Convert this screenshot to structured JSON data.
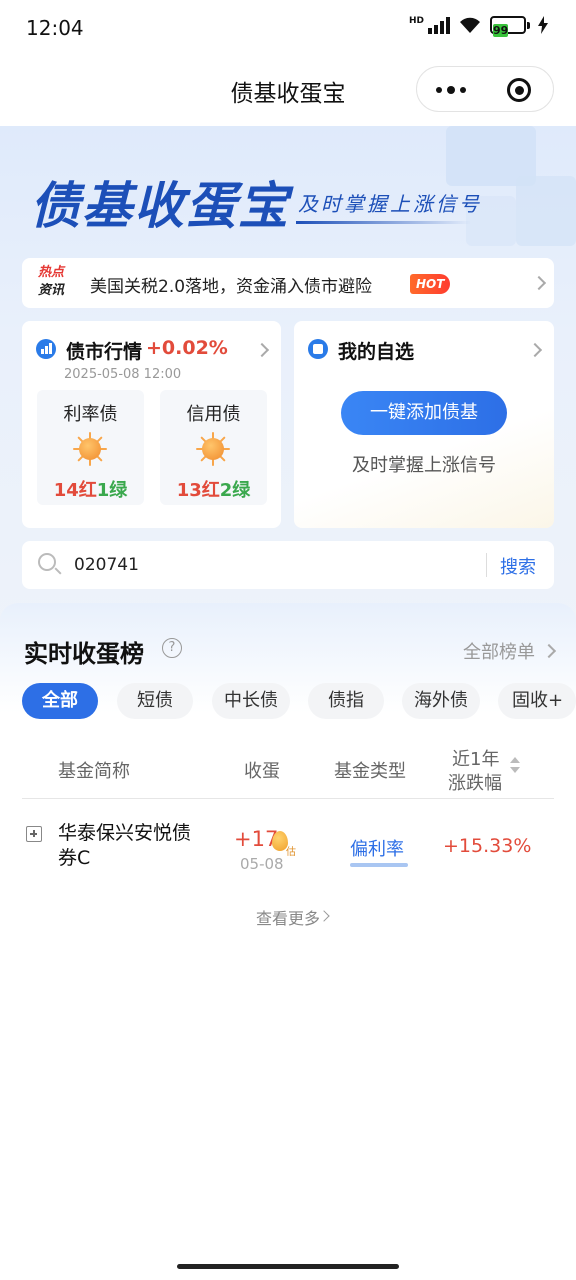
{
  "status_bar": {
    "time": "12:04",
    "network": "HD",
    "battery": "99"
  },
  "nav": {
    "title": "债基收蛋宝"
  },
  "hero": {
    "brand": "债基收蛋宝",
    "slogan": "及时掌握上涨信号"
  },
  "news": {
    "tag_top": "热点",
    "tag_bottom": "资讯",
    "headline": "美国关税2.0落地，资金涌入债市避险",
    "badge": "HOT"
  },
  "market": {
    "title": "债市行情",
    "change": "+0.02%",
    "date": "2025-05-08 12:00",
    "items": [
      {
        "name": "利率债",
        "red_count": "14红",
        "green_count": "1绿"
      },
      {
        "name": "信用债",
        "red_count": "13红",
        "green_count": "2绿"
      }
    ]
  },
  "watchlist": {
    "title": "我的自选",
    "add_button": "一键添加债基",
    "subtitle": "及时掌握上涨信号"
  },
  "search": {
    "value": "020741",
    "button": "搜索"
  },
  "ranking": {
    "title": "实时收蛋榜",
    "help": "?",
    "all_link": "全部榜单",
    "tabs": [
      "全部",
      "短债",
      "中长债",
      "债指",
      "海外债",
      "固收+"
    ],
    "active_tab": 0,
    "columns": {
      "name": "基金简称",
      "eggs": "收蛋",
      "type": "基金类型",
      "perf_line1": "近1年",
      "perf_line2": "涨跌幅"
    },
    "rows": [
      {
        "name": "华泰保兴安悦债券C",
        "eggs": "+17",
        "egg_est": "估",
        "date": "05-08",
        "type": "偏利率",
        "perf": "+15.33%"
      }
    ],
    "more": "查看更多"
  }
}
